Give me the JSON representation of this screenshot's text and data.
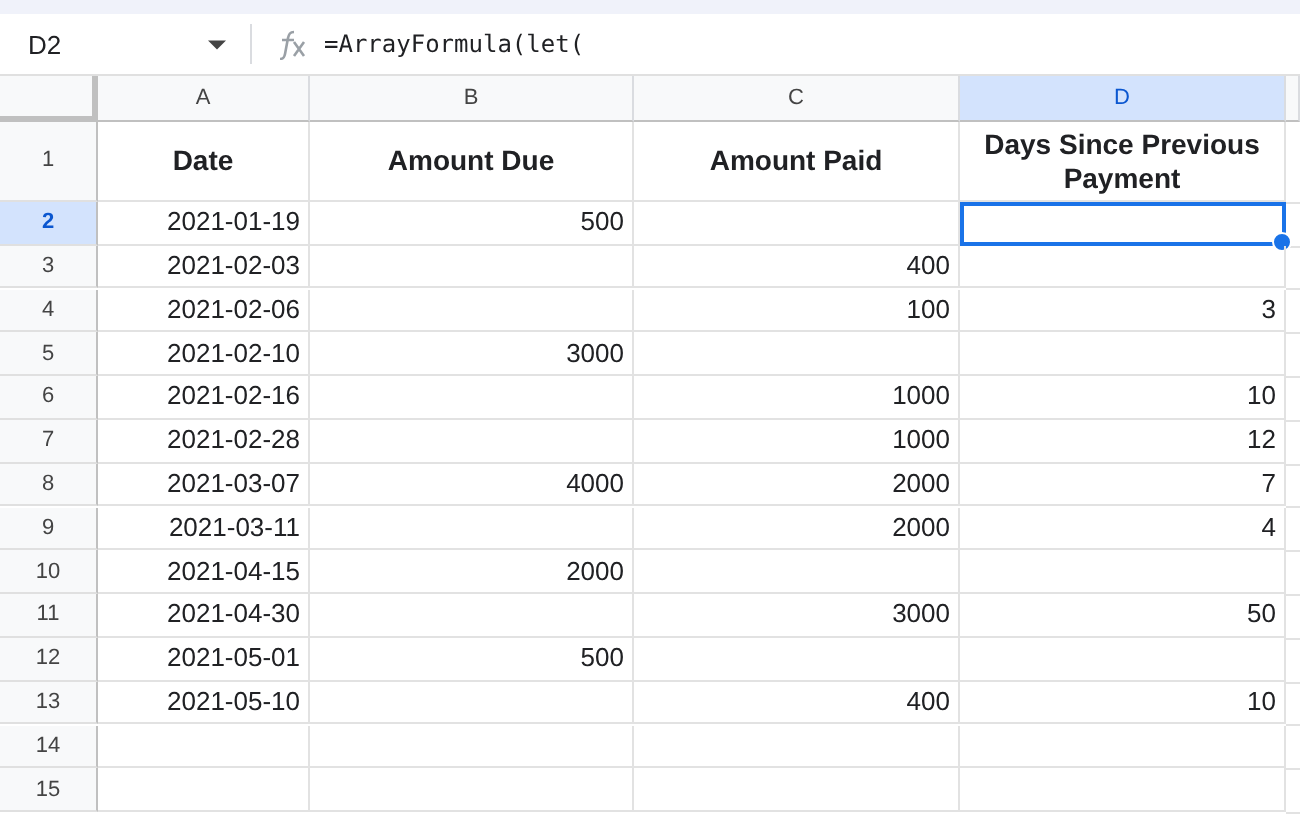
{
  "name_box": "D2",
  "formula": "=ArrayFormula(let(",
  "columns": [
    {
      "label": "A",
      "selected": false
    },
    {
      "label": "B",
      "selected": false
    },
    {
      "label": "C",
      "selected": false
    },
    {
      "label": "D",
      "selected": true
    }
  ],
  "rows": [
    {
      "number": "1",
      "kind": "header",
      "selected": false,
      "cells": [
        "Date",
        "Amount Due",
        "Amount Paid",
        "Days Since Previous Payment"
      ]
    },
    {
      "number": "2",
      "kind": "data",
      "selected": true,
      "cells": [
        "2021-01-19",
        "500",
        null,
        null
      ]
    },
    {
      "number": "3",
      "kind": "data",
      "selected": false,
      "cells": [
        "2021-02-03",
        null,
        "400",
        null
      ]
    },
    {
      "number": "4",
      "kind": "data",
      "selected": false,
      "cells": [
        "2021-02-06",
        null,
        "100",
        "3"
      ]
    },
    {
      "number": "5",
      "kind": "data",
      "selected": false,
      "cells": [
        "2021-02-10",
        "3000",
        null,
        null
      ]
    },
    {
      "number": "6",
      "kind": "data",
      "selected": false,
      "cells": [
        "2021-02-16",
        null,
        "1000",
        "10"
      ]
    },
    {
      "number": "7",
      "kind": "data",
      "selected": false,
      "cells": [
        "2021-02-28",
        null,
        "1000",
        "12"
      ]
    },
    {
      "number": "8",
      "kind": "data",
      "selected": false,
      "cells": [
        "2021-03-07",
        "4000",
        "2000",
        "7"
      ]
    },
    {
      "number": "9",
      "kind": "data",
      "selected": false,
      "cells": [
        "2021-03-11",
        null,
        "2000",
        "4"
      ]
    },
    {
      "number": "10",
      "kind": "data",
      "selected": false,
      "cells": [
        "2021-04-15",
        "2000",
        null,
        null
      ]
    },
    {
      "number": "11",
      "kind": "data",
      "selected": false,
      "cells": [
        "2021-04-30",
        null,
        "3000",
        "50"
      ]
    },
    {
      "number": "12",
      "kind": "data",
      "selected": false,
      "cells": [
        "2021-05-01",
        "500",
        null,
        null
      ]
    },
    {
      "number": "13",
      "kind": "data",
      "selected": false,
      "cells": [
        "2021-05-10",
        null,
        "400",
        "10"
      ]
    },
    {
      "number": "14",
      "kind": "data",
      "selected": false,
      "cells": [
        null,
        null,
        null,
        null
      ]
    },
    {
      "number": "15",
      "kind": "data",
      "selected": false,
      "cells": [
        null,
        null,
        null,
        null
      ]
    }
  ]
}
